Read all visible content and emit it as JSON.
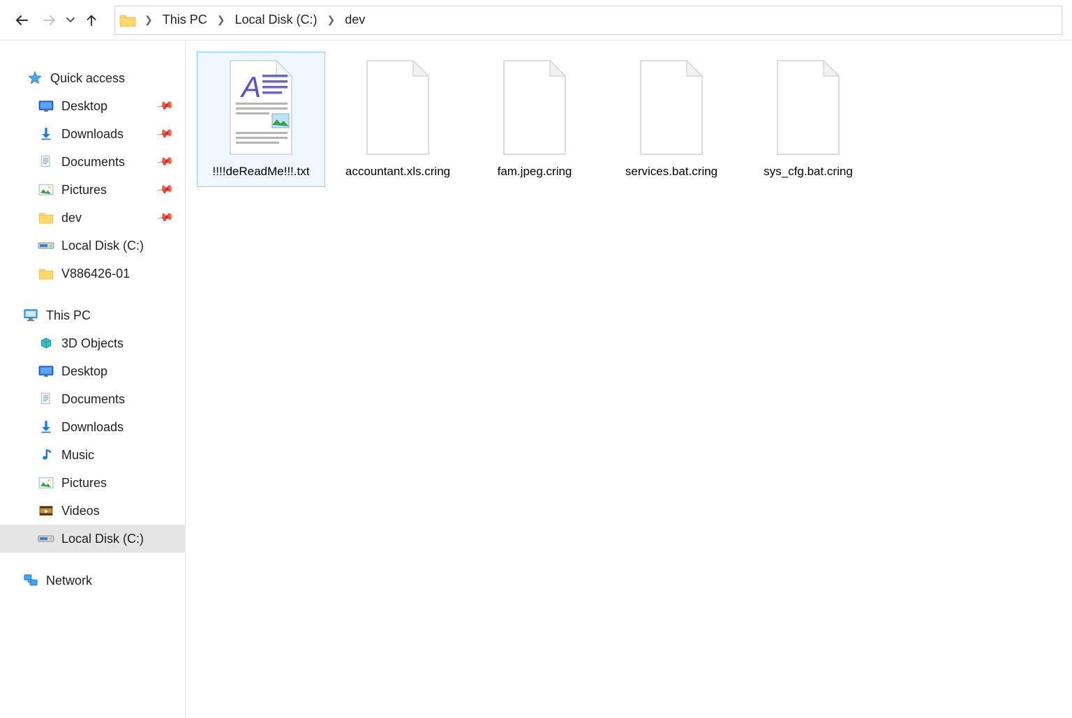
{
  "breadcrumb": {
    "segments": [
      {
        "label": "This PC"
      },
      {
        "label": "Local Disk (C:)"
      },
      {
        "label": "dev"
      }
    ]
  },
  "sidebar": {
    "quick_access": {
      "label": "Quick access"
    },
    "qa_items": [
      {
        "label": "Desktop",
        "icon": "desktop",
        "pinned": true
      },
      {
        "label": "Downloads",
        "icon": "downloads",
        "pinned": true
      },
      {
        "label": "Documents",
        "icon": "documents",
        "pinned": true
      },
      {
        "label": "Pictures",
        "icon": "pictures",
        "pinned": true
      },
      {
        "label": "dev",
        "icon": "folder",
        "pinned": true
      },
      {
        "label": "Local Disk (C:)",
        "icon": "drive",
        "pinned": false
      },
      {
        "label": "V886426-01",
        "icon": "folder",
        "pinned": false
      }
    ],
    "this_pc": {
      "label": "This PC"
    },
    "pc_items": [
      {
        "label": "3D Objects",
        "icon": "3d"
      },
      {
        "label": "Desktop",
        "icon": "desktop"
      },
      {
        "label": "Documents",
        "icon": "documents"
      },
      {
        "label": "Downloads",
        "icon": "downloads"
      },
      {
        "label": "Music",
        "icon": "music"
      },
      {
        "label": "Pictures",
        "icon": "pictures"
      },
      {
        "label": "Videos",
        "icon": "videos"
      },
      {
        "label": "Local Disk (C:)",
        "icon": "drive",
        "selected": true
      }
    ],
    "network": {
      "label": "Network"
    }
  },
  "files": [
    {
      "name": "!!!!deReadMe!!!.txt",
      "icon": "richtext",
      "selected": true
    },
    {
      "name": "accountant.xls.cring",
      "icon": "blank"
    },
    {
      "name": "fam.jpeg.cring",
      "icon": "blank"
    },
    {
      "name": "services.bat.cring",
      "icon": "blank"
    },
    {
      "name": "sys_cfg.bat.cring",
      "icon": "blank"
    }
  ]
}
